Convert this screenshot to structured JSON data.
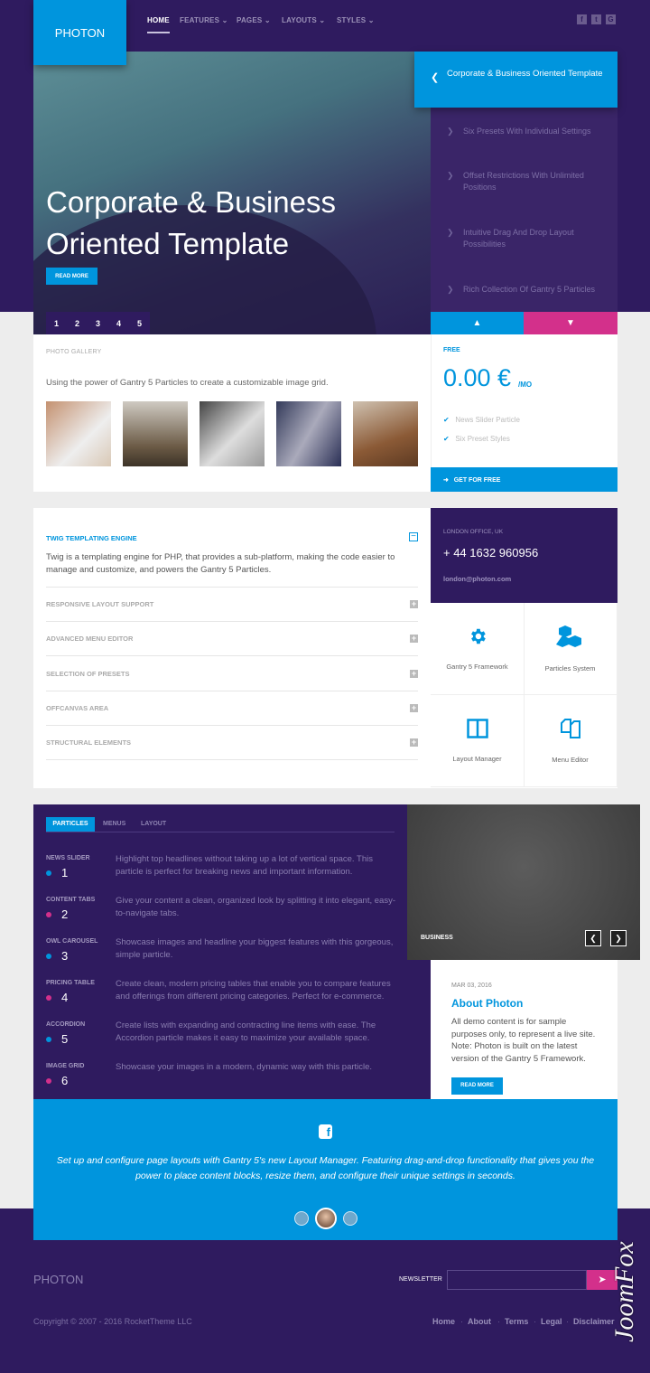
{
  "header": {
    "logo": "PHOTON",
    "nav": [
      {
        "label": "HOME",
        "active": true
      },
      {
        "label": "FEATURES",
        "dropdown": true
      },
      {
        "label": "PAGES",
        "dropdown": true
      },
      {
        "label": "LAYOUTS",
        "dropdown": true
      },
      {
        "label": "STYLES",
        "dropdown": true
      }
    ],
    "social": [
      "facebook-icon",
      "twitter-icon",
      "google-plus-icon"
    ]
  },
  "hero": {
    "title": "Corporate & Business Oriented Template",
    "read_more": "READ MORE",
    "pages": [
      "1",
      "2",
      "3",
      "4",
      "5"
    ],
    "active_page": "1"
  },
  "slider_list": {
    "active": "Corporate & Business Oriented Template",
    "items": [
      "Six Presets With Individual Settings",
      "Offset Restrictions With Unlimited Positions",
      "Intuitive Drag And Drop Layout Possibilities",
      "Rich Collection Of Gantry 5 Particles"
    ]
  },
  "gallery": {
    "label": "PHOTO GALLERY",
    "text": "Using the power of Gantry 5 Particles to create a customizable image grid."
  },
  "pricing": {
    "label": "FREE",
    "price": "0.00 €",
    "period": "/MO",
    "features": [
      "News Slider Particle",
      "Six Preset Styles"
    ],
    "button": "GET FOR FREE"
  },
  "accordion": {
    "open_title": "TWIG TEMPLATING ENGINE",
    "open_text": "Twig is a templating engine for PHP, that provides a sub-platform, making the code easier to manage and customize, and powers the Gantry 5 Particles.",
    "items": [
      "RESPONSIVE LAYOUT SUPPORT",
      "ADVANCED MENU EDITOR",
      "SELECTION OF PRESETS",
      "OFFCANVAS AREA",
      "STRUCTURAL ELEMENTS"
    ]
  },
  "contact": {
    "office": "LONDON OFFICE, UK",
    "phone": "+ 44 1632 960956",
    "email": "london@photon.com"
  },
  "features": [
    {
      "label": "Gantry 5 Framework",
      "icon": "gear-icon"
    },
    {
      "label": "Particles System",
      "icon": "cubes-icon"
    },
    {
      "label": "Layout Manager",
      "icon": "columns-icon"
    },
    {
      "label": "Menu Editor",
      "icon": "copy-icon"
    }
  ],
  "tabs": {
    "items": [
      "PARTICLES",
      "MENUS",
      "LAYOUT"
    ],
    "active": "PARTICLES"
  },
  "particles": [
    {
      "title": "NEWS SLIDER",
      "num": "1",
      "color": "#0095dd",
      "desc": "Highlight top headlines without taking up a lot of vertical space. This particle is perfect for breaking news and important information."
    },
    {
      "title": "CONTENT TABS",
      "num": "2",
      "color": "#d3308b",
      "desc": "Give your content a clean, organized look by splitting it into elegant, easy-to-navigate tabs."
    },
    {
      "title": "OWL CAROUSEL",
      "num": "3",
      "color": "#0095dd",
      "desc": "Showcase images and headline your biggest features with this gorgeous, simple particle."
    },
    {
      "title": "PRICING TABLE",
      "num": "4",
      "color": "#d3308b",
      "desc": "Create clean, modern pricing tables that enable you to compare features and offerings from different pricing categories. Perfect for e-commerce."
    },
    {
      "title": "ACCORDION",
      "num": "5",
      "color": "#0095dd",
      "desc": "Create lists with expanding and contracting line items with ease. The Accordion particle makes it easy to maximize your available space."
    },
    {
      "title": "IMAGE GRID",
      "num": "6",
      "color": "#d3308b",
      "desc": "Showcase your images in a modern, dynamic way with this particle."
    }
  ],
  "blog": {
    "image_tag": "BUSINESS",
    "date": "MAR 03, 2016",
    "title": "About Photon",
    "text": "All demo content is for sample purposes only, to represent a live site. Note: Photon is built on the latest version of the Gantry 5 Framework.",
    "read_more": "READ MORE"
  },
  "testimonial": {
    "text": "Set up and configure page layouts with Gantry 5's new Layout Manager. Featuring drag-and-drop functionality that gives you the power to place content blocks, resize them, and configure their unique settings in seconds."
  },
  "footer": {
    "logo": "PHOTON",
    "newsletter_label": "NEWSLETTER",
    "newsletter_placeholder": "",
    "copyright": "Copyright © 2007 - 2016 RocketTheme LLC",
    "links": [
      "Home",
      "About",
      "Terms",
      "Legal",
      "Disclaimer"
    ]
  },
  "watermark": "JoomFox CREATIVE WEB STUDIO",
  "colors": {
    "purple": "#2f1b5f",
    "blue": "#0095dd",
    "pink": "#d3308b"
  }
}
